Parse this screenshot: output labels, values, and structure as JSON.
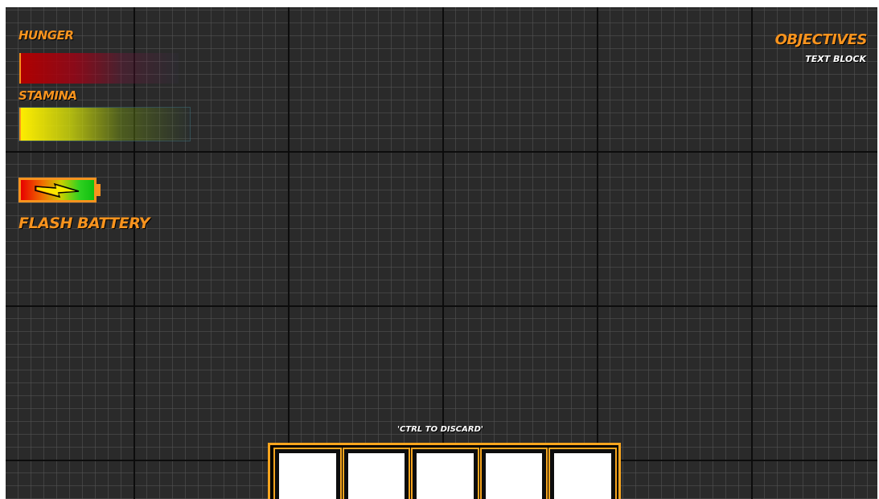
{
  "hud": {
    "hunger": {
      "label": "Hunger",
      "level": 1.0
    },
    "stamina": {
      "label": "Stamina",
      "level": 1.0
    },
    "flash_battery": {
      "label": "Flash Battery",
      "charge": 1.0
    }
  },
  "objectives": {
    "title": "Objectives",
    "text": "Text Block"
  },
  "inventory": {
    "hint": "'Ctrl to Discard'",
    "slots": [
      "",
      "",
      "",
      "",
      ""
    ]
  },
  "colors": {
    "accent": "#f7931e",
    "hunger": "#b00000",
    "stamina": "#ffee00",
    "background": "#2a2a2a"
  }
}
